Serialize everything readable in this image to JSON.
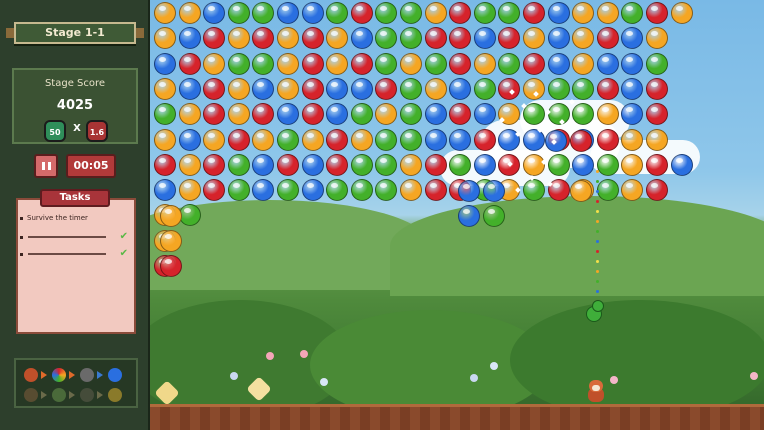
{
  "sidebar": {
    "stage_title": "Stage 1-1",
    "score_label": "Stage Score",
    "score_value": "4025",
    "multiplier_left": "50",
    "multiplier_sign": "X",
    "multiplier_right": "1.6",
    "timer": "00:05",
    "tasks_title": "Tasks",
    "tasks": [
      {
        "label": "Survive the timer",
        "done": false
      },
      {
        "label": "",
        "done": true
      },
      {
        "label": "",
        "done": true
      }
    ],
    "evolution_icons": [
      "red-panda-icon",
      "rainbow-bubble-icon",
      "raccoon-icon",
      "blue-orb-icon",
      "red-panda-faded-icon",
      "green-orb-icon",
      "raccoon-faded-icon",
      "gold-orb-icon"
    ]
  },
  "colors": {
    "orange": "#f5a623",
    "blue": "#2a6fe0",
    "green": "#43b02a",
    "red": "#d6232b",
    "accent_red": "#b23a3a",
    "panel_green": "#2d3f2c"
  },
  "board": {
    "rows": [
      "ooBGgBBGRgGoRGGRBooGRo",
      "oBRoRoRoBGGRRBRoBoRBo",
      "BRogGoRoRGoGRoGRBoBBG",
      "oBRoBoRBBRGoBGRoGGRBR",
      "GoRoRBRBGoGBRBoGGGoBR",
      "oBoRoGoRoGGBBRBBRBRoo",
      "RoRGBRBRGGoRGBRoGBGoRB",
      "BoRGBGBGGGoRRGoGRoGoR",
      "oG..........................",
      "o.",
      "R."
    ],
    "launcher_color": "green"
  },
  "scene": {
    "character": "red-panda-icon"
  }
}
